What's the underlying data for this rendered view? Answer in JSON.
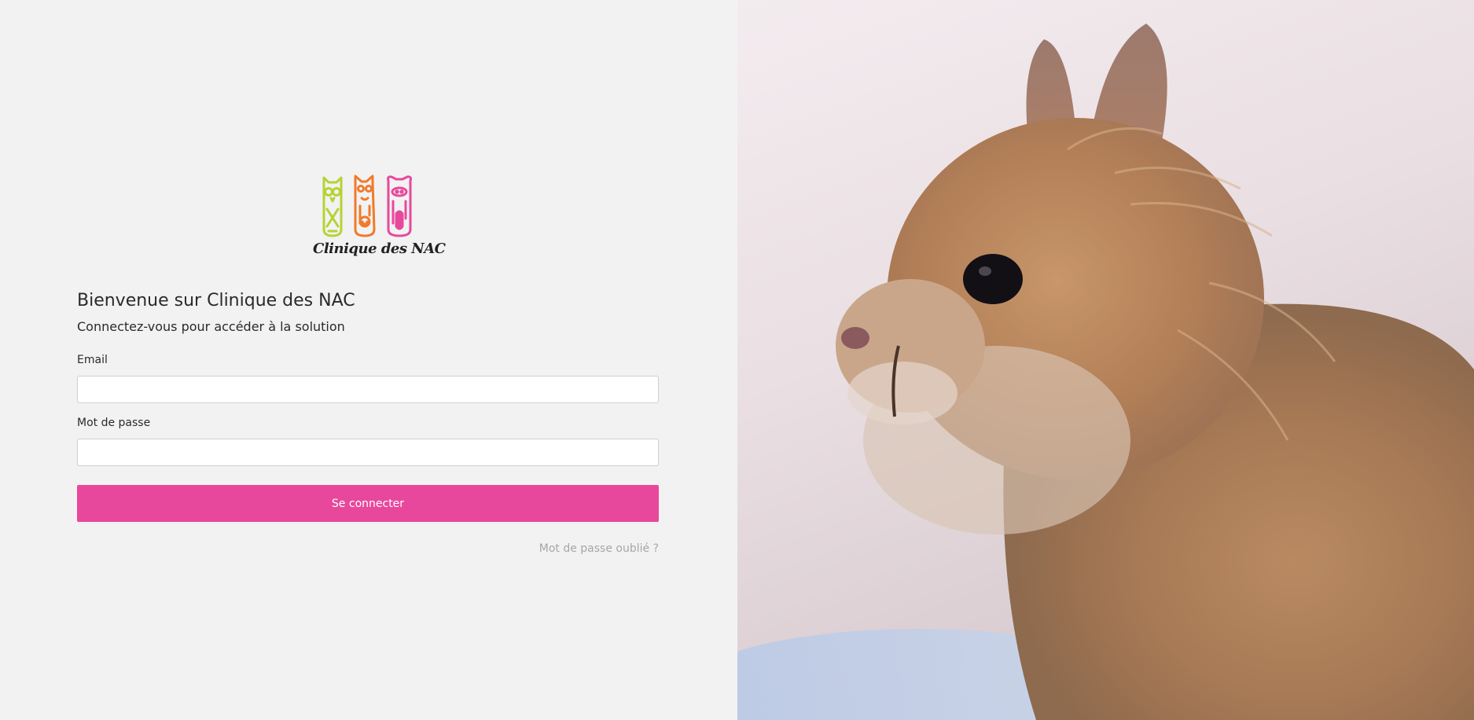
{
  "brand": {
    "logo_text": "Clinique des NAC",
    "colors": {
      "owl": "#b5d334",
      "fox": "#f07a2c",
      "pig": "#e8489c"
    }
  },
  "login": {
    "title": "Bienvenue sur Clinique des NAC",
    "subtitle": "Connectez-vous pour accéder à la solution",
    "email_label": "Email",
    "email_value": "",
    "password_label": "Mot de passe",
    "password_value": "",
    "submit_label": "Se connecter",
    "forgot_label": "Mot de passe oublié ?"
  },
  "theme": {
    "accent": "#e8489c",
    "panel_background": "#f2f2f2",
    "muted_link": "#a6a6a6"
  },
  "hero_image": {
    "subject": "rabbit-photo"
  }
}
